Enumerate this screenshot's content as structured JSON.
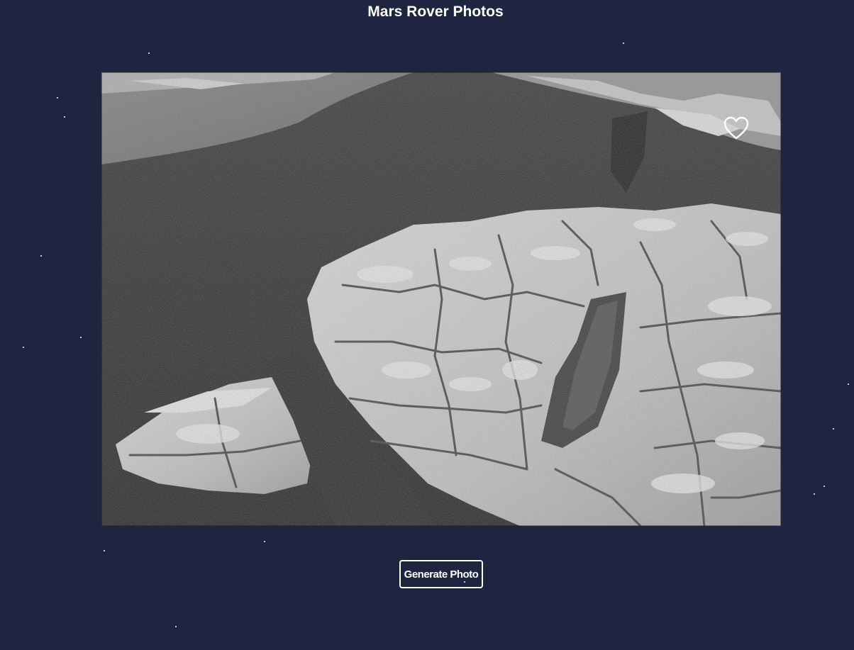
{
  "page": {
    "title": "Mars Rover Photos",
    "background_color": "#1e2540"
  },
  "photo": {
    "alt": "Mars rover photo"
  },
  "favorite": {
    "icon": "heart-outline-icon"
  },
  "controls": {
    "generate_label": "Generate Photo"
  }
}
